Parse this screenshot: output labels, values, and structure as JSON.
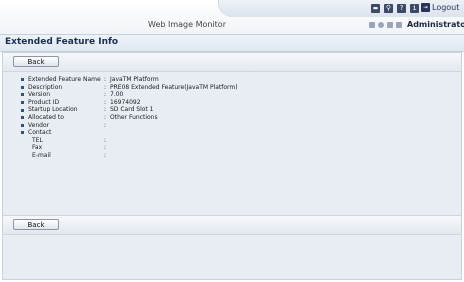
{
  "header": {
    "app_title": "Web Image Monitor",
    "logout_label": "Logout",
    "user": "Administrator",
    "icons": [
      "keyboard-icon",
      "search-icon",
      "help-icon",
      "info-icon",
      "logout-icon"
    ]
  },
  "page": {
    "title": "Extended Feature Info",
    "back_label": "Back"
  },
  "details": [
    {
      "label": "Extended Feature Name",
      "value": "JavaTM Platform",
      "bullet": true
    },
    {
      "label": "Description",
      "value": "PRE08 Extended Feature(JavaTM Platform)",
      "bullet": true
    },
    {
      "label": "Version",
      "value": "7.00",
      "bullet": true
    },
    {
      "label": "Product ID",
      "value": "16974092",
      "bullet": true
    },
    {
      "label": "Startup Location",
      "value": "SD Card Slot 1",
      "bullet": true
    },
    {
      "label": "Allocated to",
      "value": "Other Functions",
      "bullet": true
    },
    {
      "label": "Vendor",
      "value": "",
      "bullet": true
    }
  ],
  "contact": {
    "label": "Contact",
    "tel_label": "TEL",
    "tel": "",
    "fax_label": "Fax",
    "fax": "",
    "email_label": "E-mail",
    "email": ""
  },
  "colors": {
    "accent": "#33507e",
    "panel_bg": "#e8ecf3",
    "header_text": "#1e3050"
  }
}
